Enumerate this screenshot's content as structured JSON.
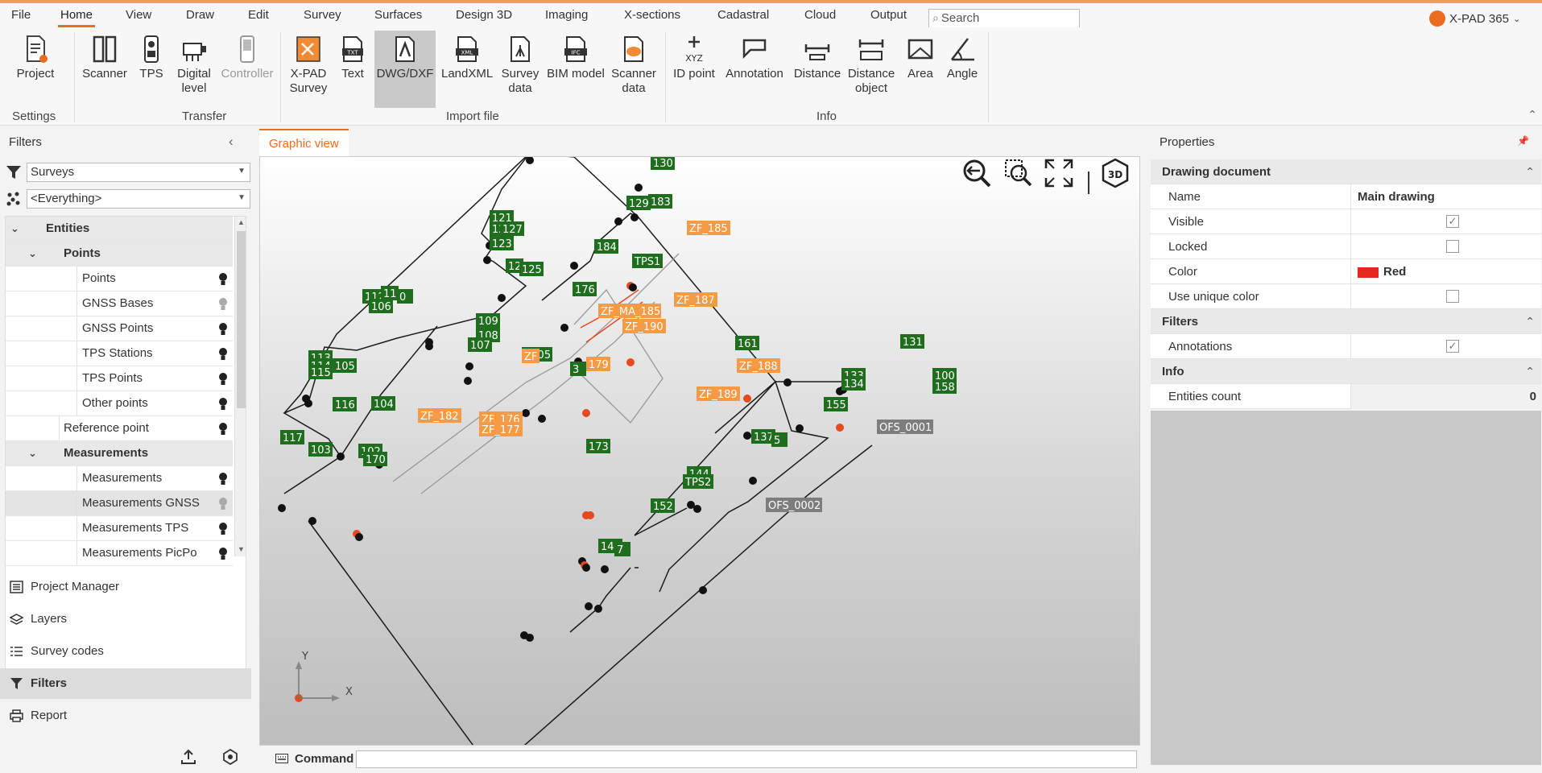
{
  "menu": {
    "items": [
      "File",
      "Home",
      "View",
      "Draw",
      "Edit",
      "Survey",
      "Surfaces",
      "Design 3D",
      "Imaging",
      "X-sections",
      "Cadastral",
      "Cloud",
      "Output"
    ],
    "active": "Home",
    "search_placeholder": "Search",
    "brand": "X-PAD 365"
  },
  "ribbon": {
    "settings": {
      "label": "Settings",
      "project": "Project"
    },
    "transfer": {
      "label": "Transfer",
      "scanner": "Scanner",
      "tps": "TPS",
      "digital_level_1": "Digital",
      "digital_level_2": "level",
      "controller": "Controller"
    },
    "import": {
      "label": "Import file",
      "xpad_1": "X-PAD",
      "xpad_2": "Survey",
      "text": "Text",
      "dwg": "DWG/DXF",
      "landxml": "LandXML",
      "survey_data_1": "Survey",
      "survey_data_2": "data",
      "bim": "BIM model",
      "scanner_data_1": "Scanner",
      "scanner_data_2": "data"
    },
    "info": {
      "label": "Info",
      "id_point": "ID point",
      "annotation": "Annotation",
      "distance": "Distance",
      "distance_object_1": "Distance",
      "distance_object_2": "object",
      "area": "Area",
      "angle": "Angle"
    }
  },
  "filters_panel": {
    "title": "Filters",
    "combo1": "Surveys",
    "combo2": "<Everything>",
    "tree": {
      "entities": "Entities",
      "points_group": "Points",
      "points": "Points",
      "gnss_bases": "GNSS Bases",
      "gnss_points": "GNSS Points",
      "tps_stations": "TPS Stations",
      "tps_points": "TPS Points",
      "other_points": "Other points",
      "reference_point": "Reference point",
      "measurements_group": "Measurements",
      "measurements": "Measurements",
      "measurements_gnss": "Measurements GNSS",
      "measurements_tps": "Measurements TPS",
      "measurements_picpo": "Measurements PicPo"
    }
  },
  "nav": {
    "project_manager": "Project Manager",
    "layers": "Layers",
    "survey_codes": "Survey codes",
    "filters": "Filters",
    "report": "Report"
  },
  "graphic_view": {
    "tab": "Graphic view",
    "command_label": "Command",
    "axis_x": "X",
    "axis_y": "Y",
    "points": [
      {
        "label": "130",
        "kind": "green"
      },
      {
        "label": "129",
        "kind": "green"
      },
      {
        "label": "183",
        "kind": "green"
      },
      {
        "label": "121",
        "kind": "green"
      },
      {
        "label": "12",
        "kind": "green"
      },
      {
        "label": "127",
        "kind": "green"
      },
      {
        "label": "123",
        "kind": "green"
      },
      {
        "label": "12",
        "kind": "green"
      },
      {
        "label": "125",
        "kind": "green"
      },
      {
        "label": "184",
        "kind": "green"
      },
      {
        "label": "TPS1",
        "kind": "green"
      },
      {
        "label": "176",
        "kind": "green"
      },
      {
        "label": "112",
        "kind": "green"
      },
      {
        "label": "11",
        "kind": "green"
      },
      {
        "label": "0",
        "kind": "green"
      },
      {
        "label": "106",
        "kind": "green"
      },
      {
        "label": "109",
        "kind": "green"
      },
      {
        "label": "108",
        "kind": "green"
      },
      {
        "label": "107",
        "kind": "green"
      },
      {
        "label": "113",
        "kind": "green"
      },
      {
        "label": "114",
        "kind": "green"
      },
      {
        "label": "115",
        "kind": "green"
      },
      {
        "label": "105",
        "kind": "green"
      },
      {
        "label": "1005",
        "kind": "green"
      },
      {
        "label": "179",
        "kind": "orange"
      },
      {
        "label": "3",
        "kind": "green"
      },
      {
        "label": "161",
        "kind": "green"
      },
      {
        "label": "131",
        "kind": "green"
      },
      {
        "label": "133",
        "kind": "green"
      },
      {
        "label": "134",
        "kind": "green"
      },
      {
        "label": "100",
        "kind": "green"
      },
      {
        "label": "158",
        "kind": "green"
      },
      {
        "label": "155",
        "kind": "green"
      },
      {
        "label": "116",
        "kind": "green"
      },
      {
        "label": "104",
        "kind": "green"
      },
      {
        "label": "117",
        "kind": "green"
      },
      {
        "label": "103",
        "kind": "green"
      },
      {
        "label": "102",
        "kind": "green"
      },
      {
        "label": "170",
        "kind": "green"
      },
      {
        "label": "173",
        "kind": "green"
      },
      {
        "label": "137",
        "kind": "green"
      },
      {
        "label": "5",
        "kind": "green"
      },
      {
        "label": "144",
        "kind": "green"
      },
      {
        "label": "TPS2",
        "kind": "green"
      },
      {
        "label": "152",
        "kind": "green"
      },
      {
        "label": "149",
        "kind": "green"
      },
      {
        "label": "7",
        "kind": "green"
      },
      {
        "label": "ZF_185",
        "kind": "orange"
      },
      {
        "label": "ZF_187",
        "kind": "orange"
      },
      {
        "label": "ZF_MA_185",
        "kind": "orange"
      },
      {
        "label": "ZF_190",
        "kind": "orange"
      },
      {
        "label": "ZF_188",
        "kind": "orange"
      },
      {
        "label": "ZF_189",
        "kind": "orange"
      },
      {
        "label": "ZF_182",
        "kind": "orange"
      },
      {
        "label": "ZF_176",
        "kind": "orange"
      },
      {
        "label": "ZF_177",
        "kind": "orange"
      },
      {
        "label": "ZF",
        "kind": "orange"
      },
      {
        "label": "OFS_0001",
        "kind": "gray"
      },
      {
        "label": "OFS_0002",
        "kind": "gray"
      }
    ]
  },
  "properties": {
    "title": "Properties",
    "sections": {
      "drawing_document": "Drawing document",
      "filters": "Filters",
      "info": "Info"
    },
    "rows": {
      "name_label": "Name",
      "name_value": "Main drawing",
      "visible_label": "Visible",
      "visible_checked": true,
      "locked_label": "Locked",
      "locked_checked": false,
      "color_label": "Color",
      "color_value": "Red",
      "color_hex": "#e6261f",
      "unique_color_label": "Use unique color",
      "unique_color_checked": false,
      "annotations_label": "Annotations",
      "annotations_checked": true,
      "entities_count_label": "Entities count",
      "entities_count_value": "0"
    }
  },
  "colors": {
    "accent": "#ec6c1f",
    "point_green": "#1e6e1e",
    "point_orange": "#f59a45",
    "point_gray": "#7d7d7d"
  }
}
